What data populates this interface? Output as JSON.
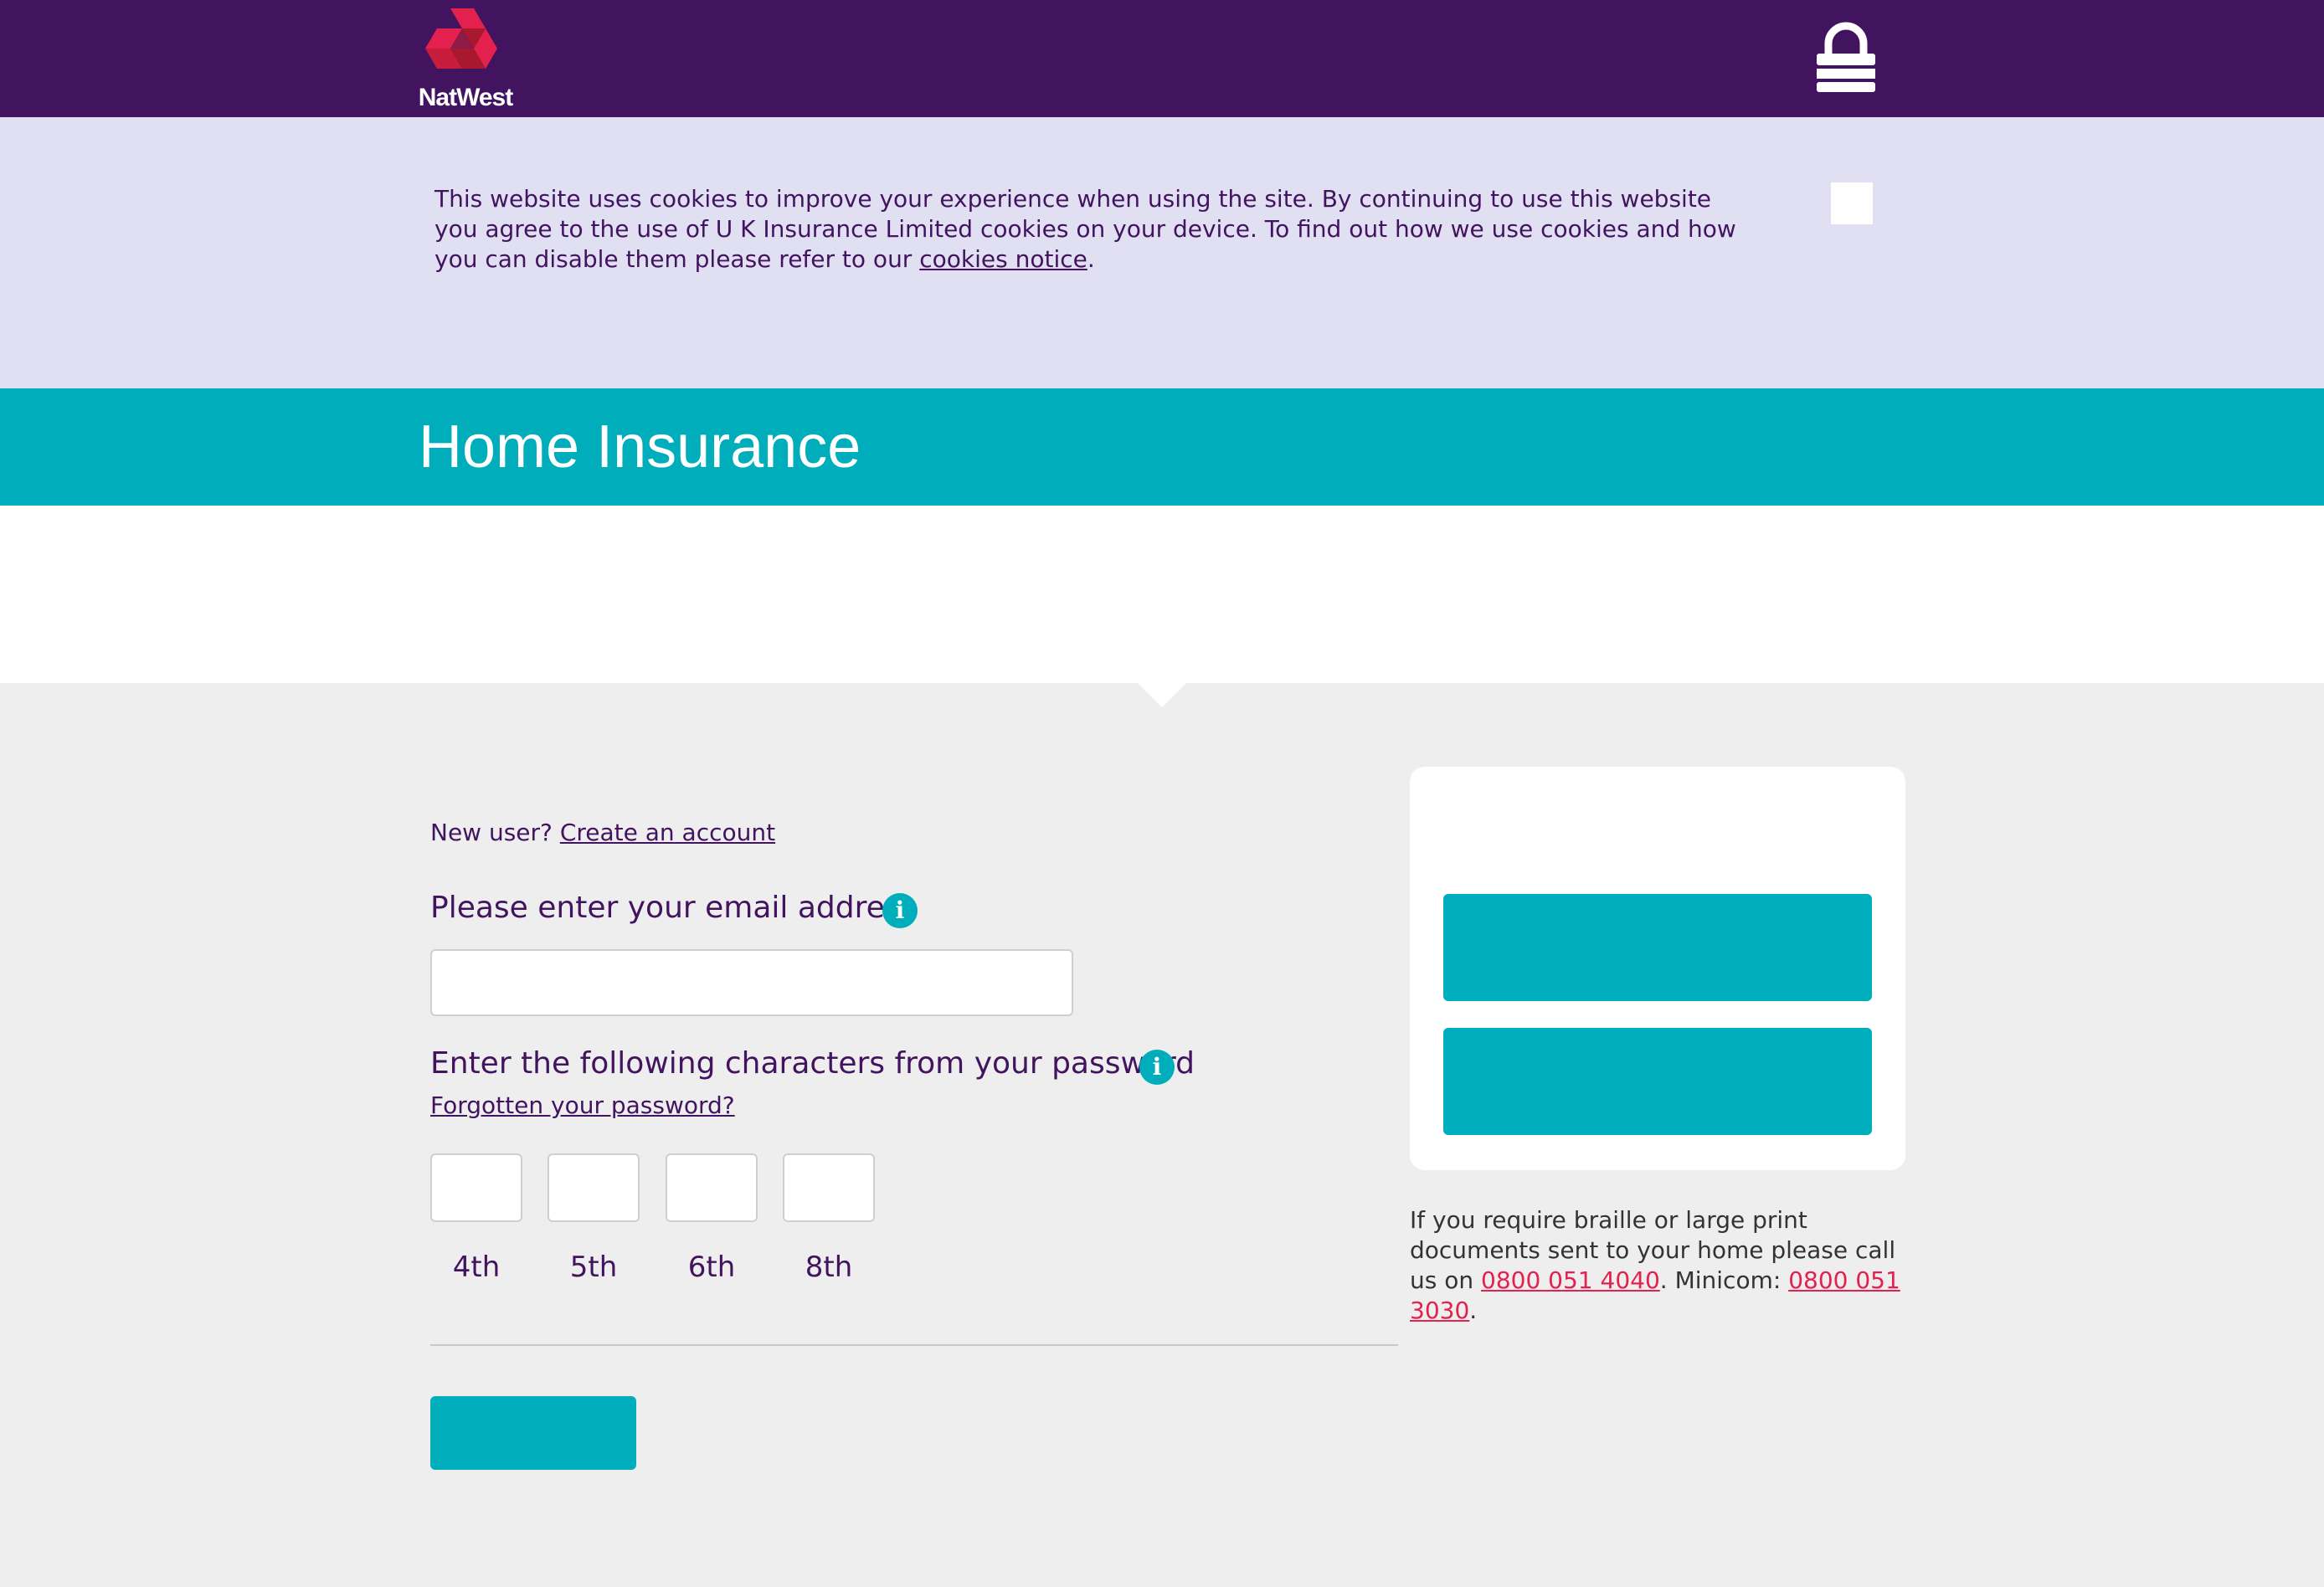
{
  "header": {
    "brand": "NatWest",
    "logo_icon": "natwest-cubes-logo",
    "lock_icon": "lock-icon",
    "colors": {
      "header_bg": "#42145f",
      "logo_red": "#e4214e"
    }
  },
  "cookie_banner": {
    "text": "This website uses cookies to improve your experience when using the site. By continuing to use this website you agree to the use of U K Insurance Limited cookies on your device. To find out how we use cookies and how you can disable them please refer to our ",
    "link_label": "cookies notice",
    "end": ".",
    "close_icon": "close-icon"
  },
  "page": {
    "title": "Home Insurance",
    "accent": "#00adbb"
  },
  "login": {
    "new_user_prefix": "New user?",
    "create_account_label": "Create an account",
    "email_label": "Please enter your email address",
    "email_value": "",
    "password_label": "Enter the following characters from your password",
    "forgot_label": "Forgotten your password?",
    "characters": [
      {
        "label": "4th",
        "value": ""
      },
      {
        "label": "5th",
        "value": ""
      },
      {
        "label": "6th",
        "value": ""
      },
      {
        "label": "8th",
        "value": ""
      }
    ],
    "info_icon": "info-icon"
  },
  "side": {
    "braille_text": "If you require braille or large print documents sent to your home please call us on ",
    "phone": "0800 051 4040",
    "minicom_prefix": ". Minicom: ",
    "minicom": "0800 051 3030",
    "end": "."
  }
}
